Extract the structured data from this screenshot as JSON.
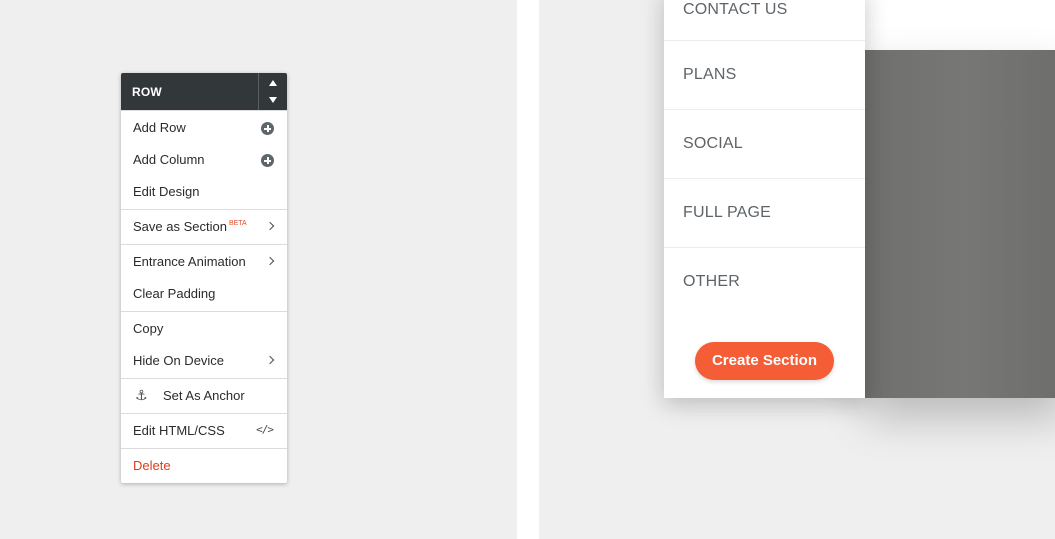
{
  "context_menu": {
    "title": "ROW",
    "groups": [
      [
        {
          "label": "Add Row",
          "icon": "plus-circle-icon"
        },
        {
          "label": "Add Column",
          "icon": "plus-circle-icon"
        },
        {
          "label": "Edit Design"
        }
      ],
      [
        {
          "label": "Save as Section",
          "badge": "BETA",
          "icon": "chevron-right-icon"
        }
      ],
      [
        {
          "label": "Entrance Animation",
          "icon": "chevron-right-icon"
        },
        {
          "label": "Clear Padding"
        }
      ],
      [
        {
          "label": "Copy"
        },
        {
          "label": "Hide On Device",
          "icon": "chevron-right-icon"
        }
      ],
      [
        {
          "label": "Set As Anchor",
          "icon": "anchor-icon"
        }
      ],
      [
        {
          "label": "Edit HTML/CSS",
          "icon": "code-icon"
        }
      ],
      [
        {
          "label": "Delete",
          "color": "#e03c1e"
        }
      ]
    ]
  },
  "section_panel": {
    "categories": [
      "CONTACT US",
      "PLANS",
      "SOCIAL",
      "FULL PAGE",
      "OTHER"
    ],
    "create_button": "Create Section",
    "accent": "#f45d35"
  }
}
